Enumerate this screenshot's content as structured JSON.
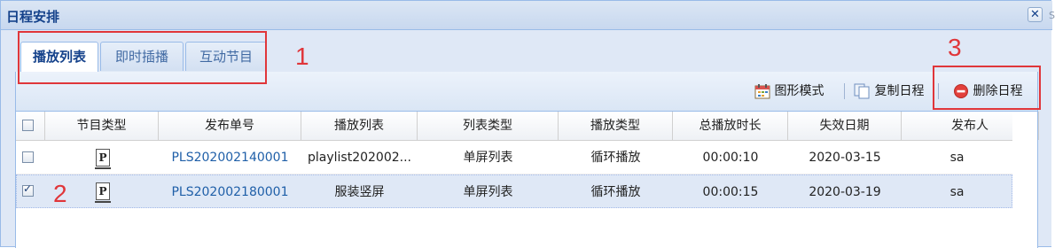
{
  "window": {
    "title": "日程安排",
    "close_glyph": "✕",
    "edge_glyph": "S"
  },
  "tabs": [
    {
      "label": "播放列表",
      "active": true
    },
    {
      "label": "即时插播",
      "active": false
    },
    {
      "label": "互动节目",
      "active": false
    }
  ],
  "toolbar": {
    "chart_mode_label": "图形模式",
    "copy_schedule_label": "复制日程",
    "delete_schedule_label": "删除日程"
  },
  "table": {
    "columns": [
      "节目类型",
      "发布单号",
      "播放列表",
      "列表类型",
      "播放类型",
      "总播放时长",
      "失效日期",
      "发布人"
    ],
    "rows": [
      {
        "checked": false,
        "type_icon": "P",
        "order_no": "PLS202002140001",
        "playlist": "playlist202002...",
        "list_type": "单屏列表",
        "play_type": "循环播放",
        "duration": "00:00:10",
        "expire_date": "2020-03-15",
        "publisher": "sa",
        "selected": false
      },
      {
        "checked": true,
        "type_icon": "P",
        "order_no": "PLS202002180001",
        "playlist": "服装竖屏",
        "list_type": "单屏列表",
        "play_type": "循环播放",
        "duration": "00:00:15",
        "expire_date": "2020-03-19",
        "publisher": "sa",
        "selected": true
      }
    ]
  },
  "annotations": {
    "marker_1": "1",
    "marker_2": "2",
    "marker_3": "3",
    "color": "#e0363a"
  },
  "colors": {
    "title_text": "#15428b",
    "border": "#99bbe8",
    "selected_row": "#dfe8f6",
    "link": "#1f5fa8"
  }
}
